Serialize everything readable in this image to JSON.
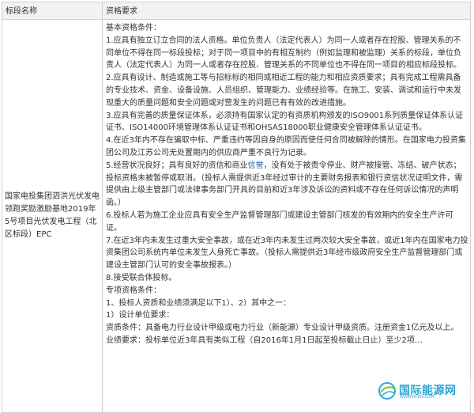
{
  "table": {
    "header": {
      "name_col": "标段名称",
      "req_col": "资格要求"
    },
    "row": {
      "name": "国家电投集团泗洪光伏发电领跑奖励激励基地2019年5号项目光伏发电工程（北区标段）EPC",
      "basic_title": "基本资格条件：",
      "c1": "1.应具有独立订立合同的法人资格。单位负责人（法定代表人）为同一人或者存在控股、管理关系的不同单位不得在同一标段投标；对于同一项目中的有相互制约（例如监理和被监理）关系的标段，单位负责人（法定代表人）为同一人或者存在控股、管理关系的不同单位也不得在同一项目的相应标段投标。",
      "c2": "2.应具有设计、制造或施工等与招标标的相同或相近工程的能力和相应资质要求；具有完成工程需具备的专业技术、资金、设备设施、人员组织、管理能力、业绩经验等。在施工、安装、调试和运行中未发现重大的质量问题和安全问题或对营发生的问题已有有效的改进措施。",
      "c3": "3.应具有完善的质量保证体系，必须持有国家认定的有资质机构颁发的ISO9001系列质量保证体系认证证书、ISO14000环境管理体系认证证书和OHSAS18000职业健康安全管理体系认证证书。",
      "c4": "4.在近3年内不存在骗取中标、严重违约等因自身的原因而使任何合同被解除的情形。在国家电力投资集团公司及江苏公司无处置期内的供应商严重不良行为记录。",
      "c5_before": "5.经营状况良好；具有良好的资信和商业",
      "c5_link": "信誉",
      "c5_after": "，没有处于被责令停业、财产被接管、冻结、破产状态；投标资格未被暂停或取消。（投标人需提供近3年经过审计的主要财务报表和银行资信状况证明文件，需提供由上级主管部门或法律事务部门开具的目前和近3年涉及诉讼的资料或不存在任何诉讼情况的声明函。）",
      "c6": "6.投标人若为施工企业应具有安全生产监督管理部门或建设主管部门核发的有效期内的安全生产许可证。",
      "c7": "7.在近3年内未发生过重大安全事故，或在近3年内未发生过两次较大安全事故，或近1年内在国家电力投资集团公司系统内单位未发生人身死亡事故。（投标人需提供近3年经市级政府安全生产监督管理部门或建设主管部门认可的安全事故报表。）",
      "c8": "8.接受联合体投标。",
      "special_title": "专项资格条件：",
      "s1": "1、投标人资质和业绩须满足以下1）、2）其中之一：",
      "s2": "1）设计单位要求：",
      "s3": "资质条件：具备电力行业设计甲级或电力行业（新能源）专业设计甲级资质。注册资金1亿元及以上。",
      "s4": "业绩要求：投标单位近3年具有类似工程（自2016年1月1日起至投标截止日止）至少2项…"
    }
  },
  "watermark": {
    "cn": "国际能源网",
    "en": "WWW.IN-EN.COM",
    "icon": "globe-leaf-icon",
    "color": "#27a6d8"
  }
}
